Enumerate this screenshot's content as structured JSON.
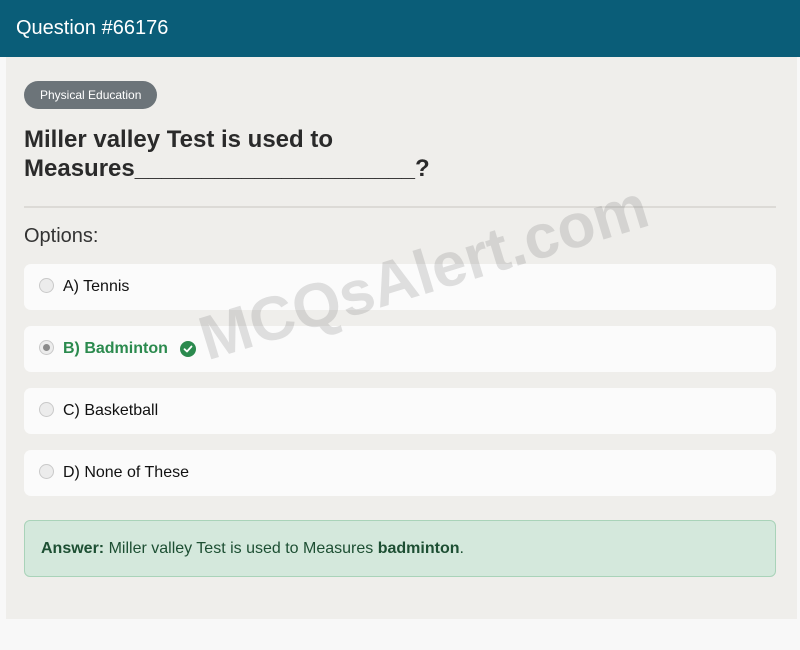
{
  "header": {
    "title": "Question #66176"
  },
  "category": "Physical Education",
  "question": {
    "line1": "Miller valley Test is used to",
    "line2": "Measures_____________________?"
  },
  "options_title": "Options:",
  "options": [
    {
      "label": "A) Tennis",
      "selected": false,
      "correct": false
    },
    {
      "label": "B) Badminton",
      "selected": true,
      "correct": true
    },
    {
      "label": "C) Basketball",
      "selected": false,
      "correct": false
    },
    {
      "label": "D) None of These",
      "selected": false,
      "correct": false
    }
  ],
  "answer": {
    "prefix": "Answer:",
    "text": "Miller valley Test is used to Measures",
    "highlight": "badminton",
    "suffix": "."
  },
  "watermark": "MCQsAlert.com",
  "colors": {
    "header_bg": "#0a5d78",
    "correct": "#2b8a4e",
    "answer_bg": "#d4e8dc",
    "badge_bg": "#6c7479"
  },
  "icons": {
    "correct": "check-circle-icon"
  }
}
